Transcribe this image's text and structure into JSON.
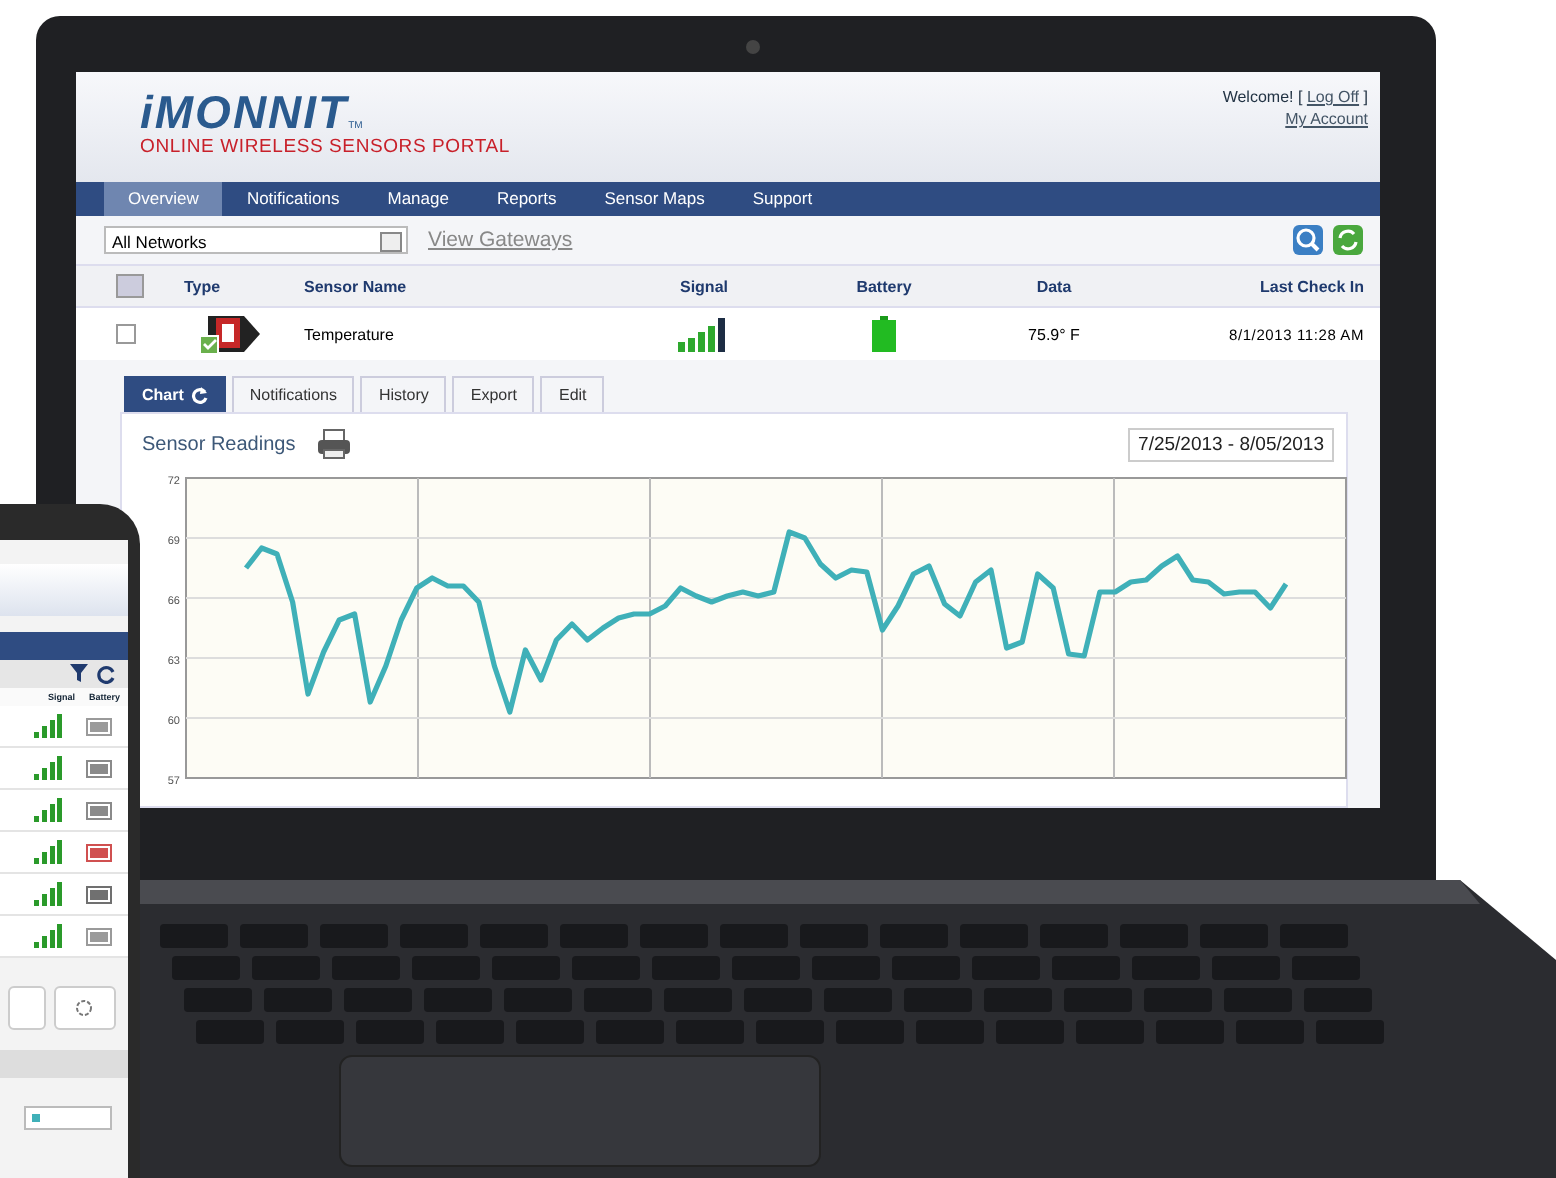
{
  "header": {
    "logo": "iMONNIT",
    "logo_tm": "TM",
    "subtitle": "ONLINE WIRELESS SENSORS PORTAL",
    "welcome": "Welcome! [",
    "log_off": "Log Off",
    "welcome_end": "]",
    "my_account": "My Account"
  },
  "nav": [
    {
      "label": "Overview",
      "selected": true
    },
    {
      "label": "Notifications",
      "selected": false
    },
    {
      "label": "Manage",
      "selected": false
    },
    {
      "label": "Reports",
      "selected": false
    },
    {
      "label": "Sensor Maps",
      "selected": false
    },
    {
      "label": "Support",
      "selected": false
    }
  ],
  "filter": {
    "network": "All Networks",
    "link": "View Gateways"
  },
  "table": {
    "select_all_checked": false,
    "columns": [
      "Type",
      "Sensor Name",
      "Signal",
      "Battery",
      "Data",
      "Last Check In"
    ],
    "rows": [
      {
        "checked": false,
        "name": "Temperature",
        "data": "75.9° F",
        "last_check_in": "8/1/2013 11:28 AM"
      }
    ]
  },
  "detail_tabs": [
    {
      "label": "Chart",
      "refresh_icon": true,
      "selected": true
    },
    {
      "label": "Notifications",
      "selected": false
    },
    {
      "label": "History",
      "selected": false
    },
    {
      "label": "Export",
      "selected": false
    },
    {
      "label": "Edit",
      "selected": false
    }
  ],
  "panel": {
    "title": "Sensor Readings",
    "date_range": "7/25/2013 - 8/05/2013",
    "chart_data": {
      "type": "line",
      "grid": true,
      "ylim": [
        57,
        72
      ],
      "yticks": [
        57,
        60,
        63,
        66,
        69,
        72
      ],
      "values": [
        67.5,
        68.5,
        68.2,
        65.8,
        61.2,
        63.3,
        64.9,
        65.2,
        60.8,
        62.6,
        64.9,
        66.5,
        67.0,
        66.6,
        66.6,
        65.8,
        62.6,
        60.3,
        63.4,
        61.9,
        63.9,
        64.7,
        63.9,
        64.5,
        65.0,
        65.2,
        65.2,
        65.6,
        66.5,
        66.1,
        65.8,
        66.1,
        66.3,
        66.1,
        66.3,
        69.3,
        69.0,
        67.7,
        67.0,
        67.4,
        67.3,
        64.4,
        65.6,
        67.2,
        67.6,
        65.7,
        65.1,
        66.8,
        67.4,
        63.5,
        63.8,
        67.2,
        66.5,
        63.2,
        63.1,
        66.3,
        66.3,
        66.8,
        66.9,
        67.6,
        68.1,
        66.9,
        66.8,
        66.2,
        66.3,
        66.3,
        65.5,
        66.7
      ]
    }
  },
  "phone": {
    "columns": [
      "Signal",
      "Battery"
    ],
    "rows": [
      {
        "color": "#9a9a9a"
      },
      {
        "color": "#8a8a8a"
      },
      {
        "color": "#8a8a8a"
      },
      {
        "color": "#d05050"
      },
      {
        "color": "#707070"
      },
      {
        "color": "#9a9a9a"
      }
    ]
  }
}
